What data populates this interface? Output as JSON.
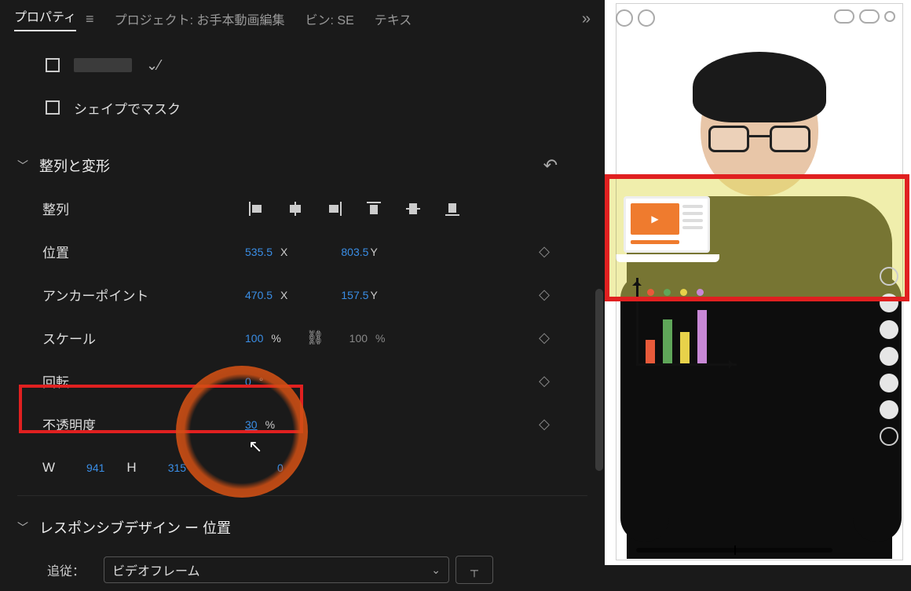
{
  "tabs": {
    "properties": "プロパティ",
    "project_prefix": "プロジェクト:",
    "project_name": "お手本動画編集",
    "bin_prefix": "ビン:",
    "bin_name": "SE",
    "text": "テキス"
  },
  "mask": {
    "shape_mask": "シェイプでマスク"
  },
  "section_transform": {
    "title": "整列と変形"
  },
  "align": {
    "label": "整列"
  },
  "position": {
    "label": "位置",
    "x": "535.5",
    "y": "803.5",
    "xu": "X",
    "yu": "Y"
  },
  "anchor": {
    "label": "アンカーポイント",
    "x": "470.5",
    "y": "157.5",
    "xu": "X",
    "yu": "Y"
  },
  "scale": {
    "label": "スケール",
    "v1": "100",
    "u": "%",
    "v2": "100"
  },
  "rotation": {
    "label": "回転",
    "v": "0",
    "u": "°"
  },
  "opacity": {
    "label": "不透明度",
    "v": "30",
    "u": "%"
  },
  "size": {
    "w_label": "W",
    "w": "941",
    "h_label": "H",
    "h": "315",
    "extra": "0"
  },
  "section_responsive": {
    "title": "レスポンシブデザイン ー 位置"
  },
  "follow": {
    "label": "追従：",
    "value": "ビデオフレーム"
  }
}
